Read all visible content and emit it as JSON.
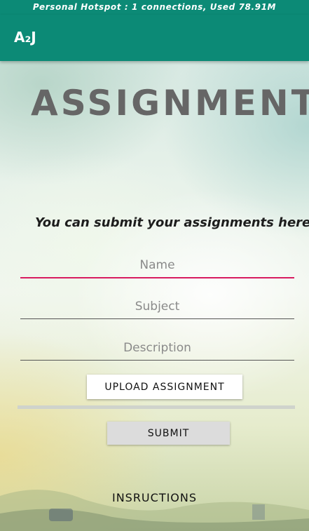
{
  "status_bar": {
    "text": "Personal Hotspot : 1 connections, Used 78.91M"
  },
  "app_bar": {
    "title": "A₂J"
  },
  "main": {
    "heading": "ASSIGNMENT",
    "intro_text": "You can submit your assignments here..",
    "fields": {
      "name_placeholder": "Name",
      "subject_placeholder": "Subject",
      "description_placeholder": "Description"
    },
    "upload_label": "UPLOAD ASSIGNMENT",
    "submit_label": "SUBMIT",
    "instructions_label": "INSRUCTIONS"
  },
  "colors": {
    "primary": "#0c8a76",
    "accent": "#d81b60"
  }
}
